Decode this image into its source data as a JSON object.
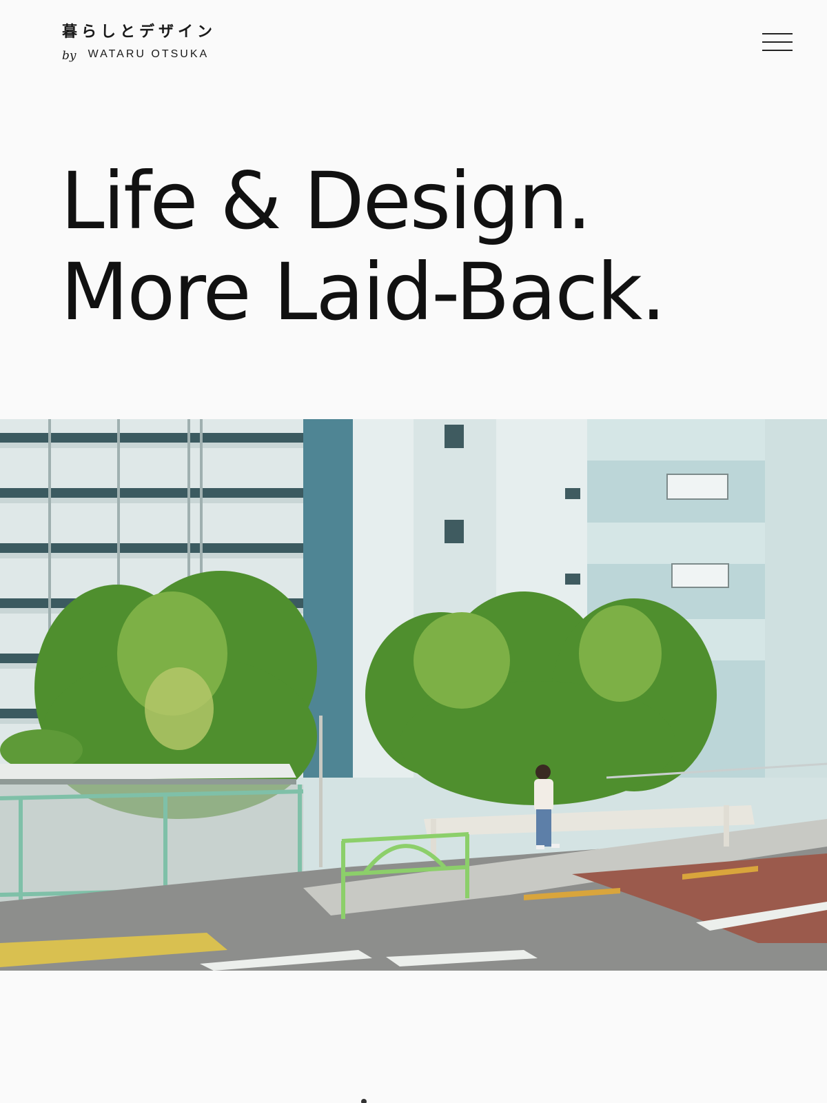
{
  "header": {
    "logo_jp": "暮らしとデザイン",
    "logo_by": "by",
    "logo_name": "WATARU OTSUKA",
    "menu_icon": "hamburger-menu-icon"
  },
  "hero": {
    "headline_line1": "Life & Design.",
    "headline_line2": "More Laid-Back."
  },
  "colors": {
    "background": "#fafafa",
    "text": "#111111"
  }
}
